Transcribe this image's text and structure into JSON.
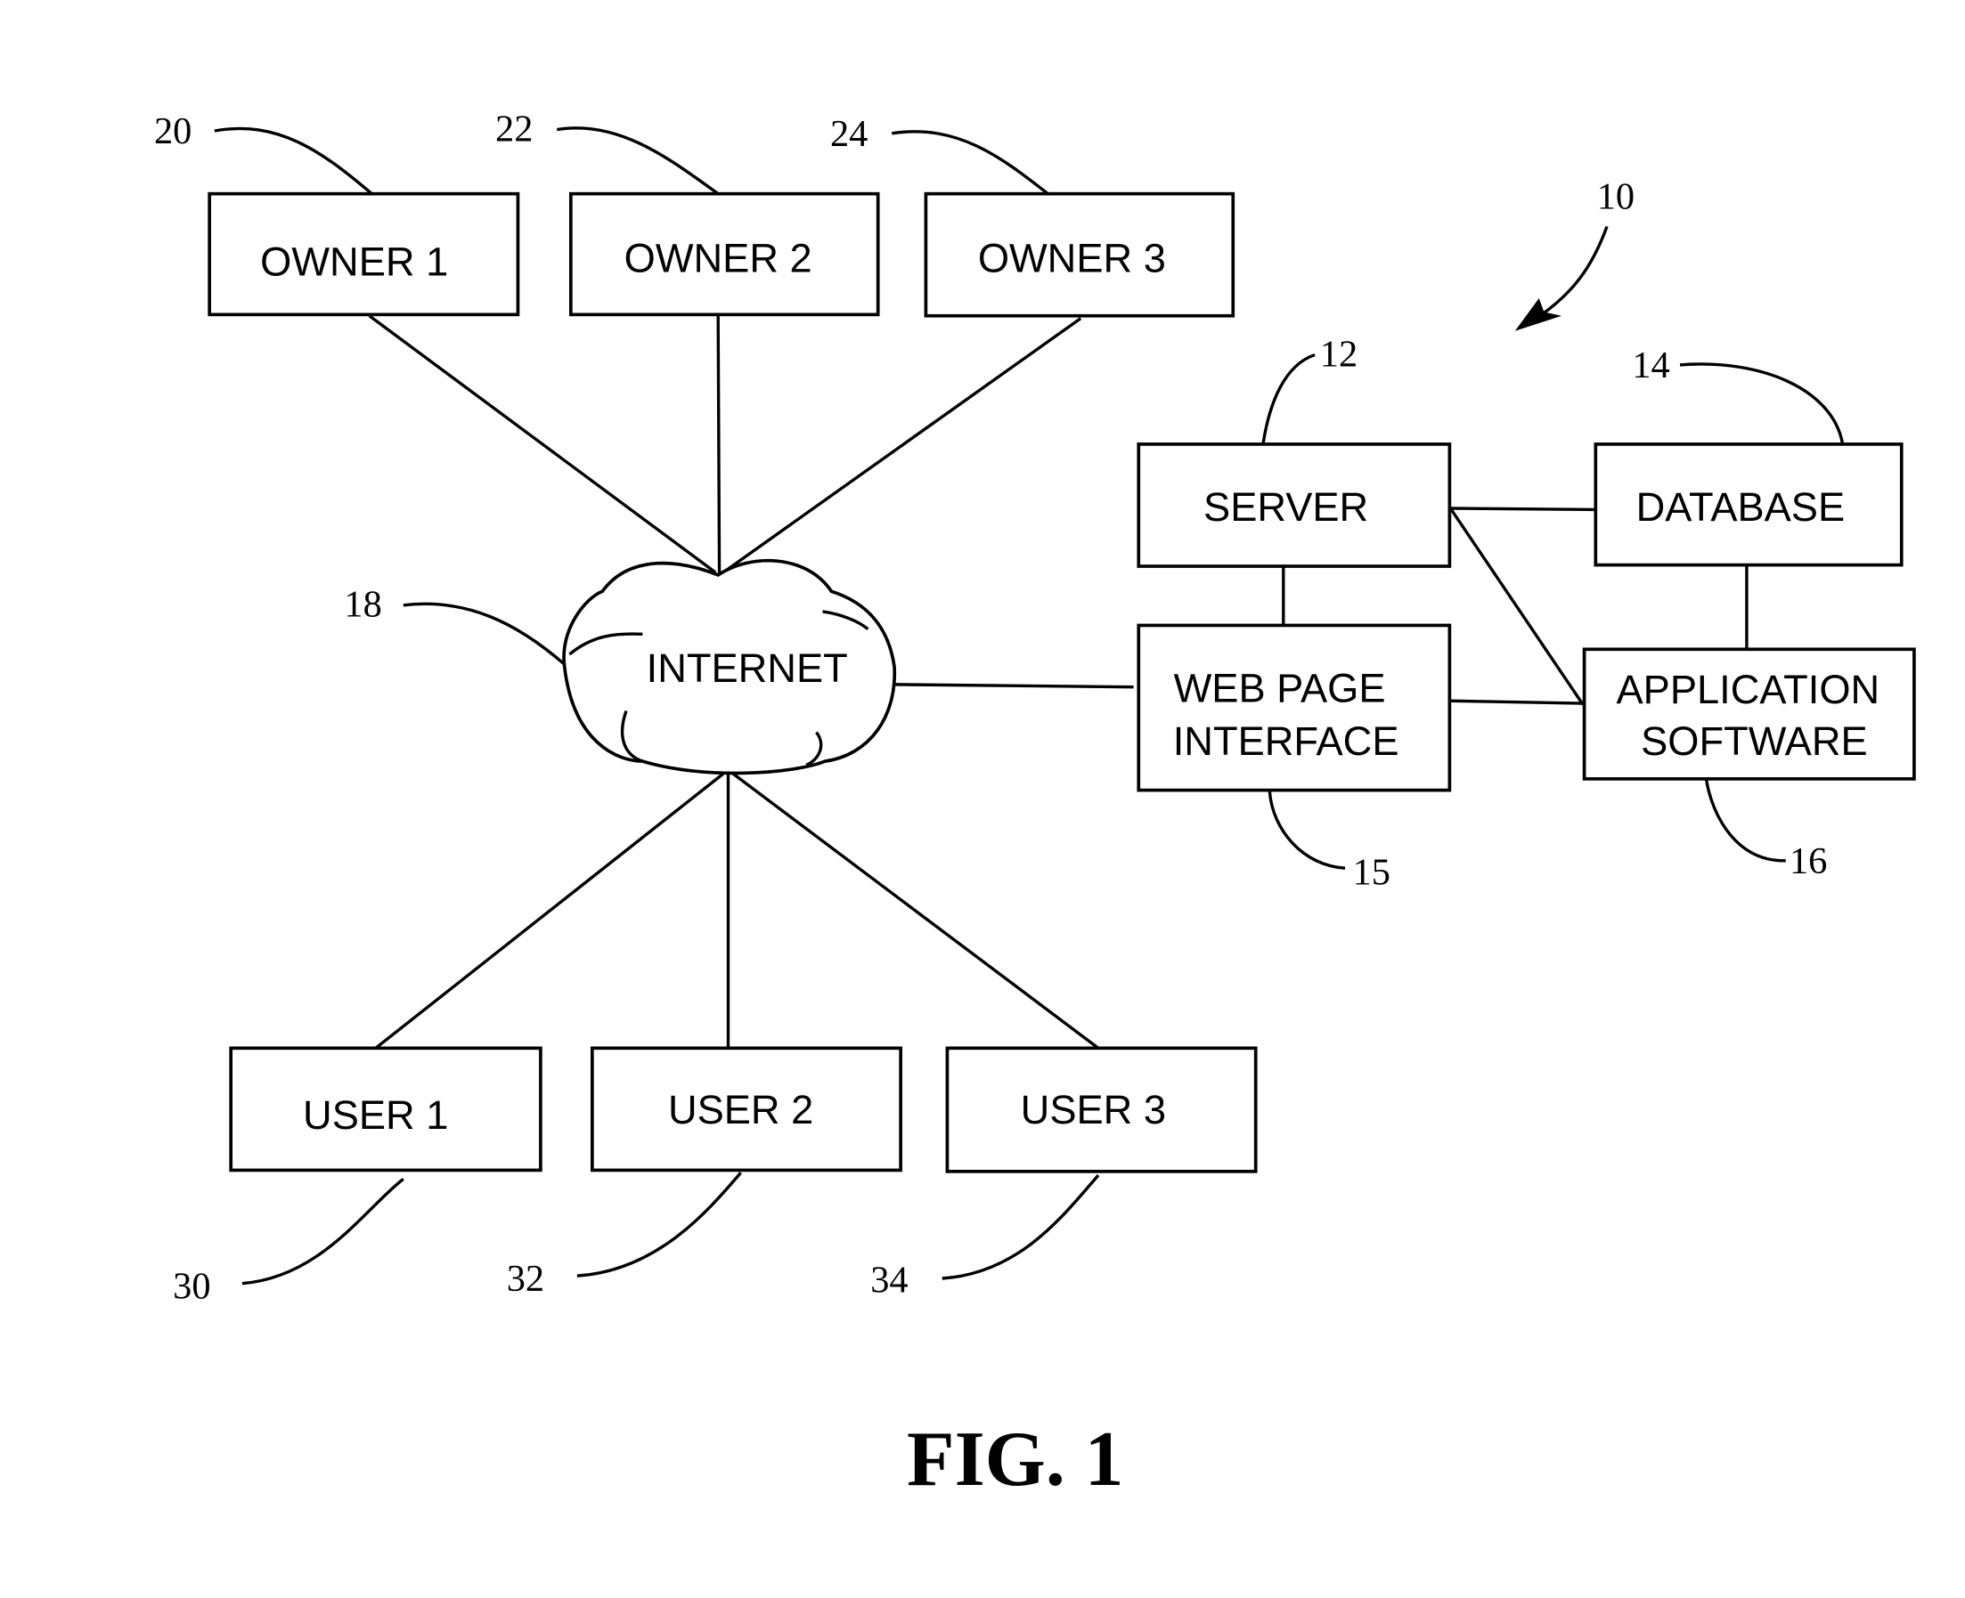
{
  "figure": {
    "caption": "FIG. 1",
    "system_ref": "10"
  },
  "nodes": {
    "owner1": {
      "label": "OWNER 1",
      "ref": "20"
    },
    "owner2": {
      "label": "OWNER 2",
      "ref": "22"
    },
    "owner3": {
      "label": "OWNER 3",
      "ref": "24"
    },
    "internet": {
      "label": "INTERNET",
      "ref": "18"
    },
    "user1": {
      "label": "USER 1",
      "ref": "30"
    },
    "user2": {
      "label": "USER 2",
      "ref": "32"
    },
    "user3": {
      "label": "USER 3",
      "ref": "34"
    },
    "server": {
      "label": "SERVER",
      "ref": "12"
    },
    "database": {
      "label": "DATABASE",
      "ref": "14"
    },
    "webpage": {
      "label_line1": "WEB PAGE",
      "label_line2": "INTERFACE",
      "ref": "15"
    },
    "appsoftware": {
      "label_line1": "APPLICATION",
      "label_line2": "SOFTWARE",
      "ref": "16"
    }
  },
  "connections": [
    [
      "owner1",
      "internet"
    ],
    [
      "owner2",
      "internet"
    ],
    [
      "owner3",
      "internet"
    ],
    [
      "internet",
      "user1"
    ],
    [
      "internet",
      "user2"
    ],
    [
      "internet",
      "user3"
    ],
    [
      "internet",
      "webpage"
    ],
    [
      "server",
      "webpage"
    ],
    [
      "server",
      "database"
    ],
    [
      "server",
      "appsoftware"
    ],
    [
      "webpage",
      "appsoftware"
    ],
    [
      "database",
      "appsoftware"
    ]
  ]
}
